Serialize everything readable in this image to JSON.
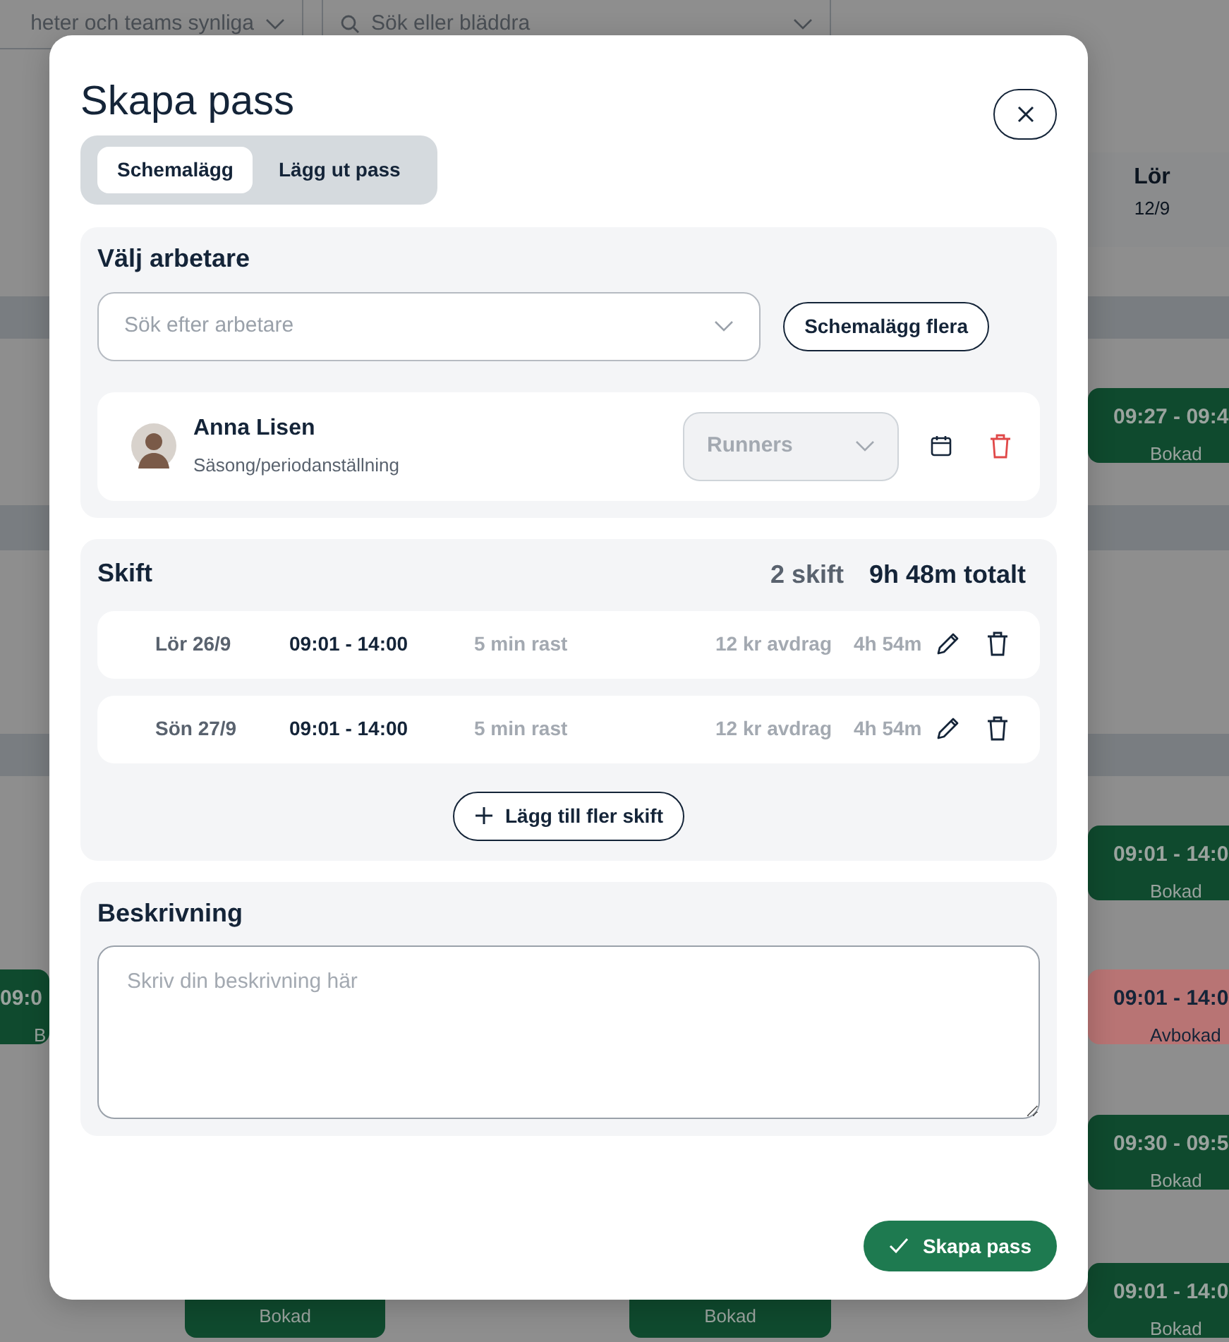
{
  "calendar": {
    "filters": [
      {
        "kind": "select",
        "text": "heter och teams synliga"
      },
      {
        "kind": "search",
        "placeholder": "Sök eller bläddra"
      }
    ],
    "day_header": {
      "day": "Lör",
      "date": "12/9"
    },
    "left_shifts": [
      {
        "time": "09:0",
        "status": "B",
        "color": "#0f4a2e"
      }
    ],
    "right_shifts": [
      {
        "time": "09:27 - 09:4",
        "status": "Bokad",
        "color": "#0f4a2e"
      },
      {
        "time": "09:01 - 14:0",
        "status": "Bokad",
        "color": "#0f4a2e"
      },
      {
        "time": "09:01 - 14:0",
        "status": "Avbokad",
        "color": "#b87474"
      },
      {
        "time": "09:30 - 09:5",
        "status": "Bokad",
        "color": "#0f4a2e"
      },
      {
        "time": "09:01 - 14:0",
        "status": "Bokad",
        "color": "#0f4a2e"
      }
    ],
    "bottom_shifts": [
      {
        "status": "Bokad",
        "color": "#0f4a2e"
      },
      {
        "status": "Bokad",
        "color": "#0f4a2e"
      }
    ]
  },
  "modal": {
    "title": "Skapa pass",
    "tabs": [
      {
        "label": "Schemalägg",
        "selected": true
      },
      {
        "label": "Lägg ut pass",
        "selected": false
      }
    ],
    "worker_section": {
      "heading": "Välj arbetare",
      "search": {
        "placeholder": "Sök efter arbetare"
      },
      "button": "Schemalägg flera",
      "workers": [
        {
          "name": "Anna Lisen",
          "role": "Säsong/periodanställning",
          "team": "Runners",
          "team_disabled": true
        }
      ]
    },
    "shift_section": {
      "heading": "Skift",
      "count": "2 skift",
      "total": "9h 48m totalt",
      "shifts": [
        {
          "date": "Lör 26/9",
          "time": "09:01 - 14:00",
          "break": "5 min rast",
          "deduction": "12 kr avdrag",
          "duration": "4h 54m"
        },
        {
          "date": "Sön 27/9",
          "time": "09:01 - 14:00",
          "break": "5 min rast",
          "deduction": "12 kr avdrag",
          "duration": "4h 54m"
        }
      ],
      "add_button": "Lägg till fler skift"
    },
    "description_section": {
      "heading": "Beskrivning",
      "placeholder": "Skriv din beskrivning här"
    },
    "submit_button": "Skapa pass"
  }
}
